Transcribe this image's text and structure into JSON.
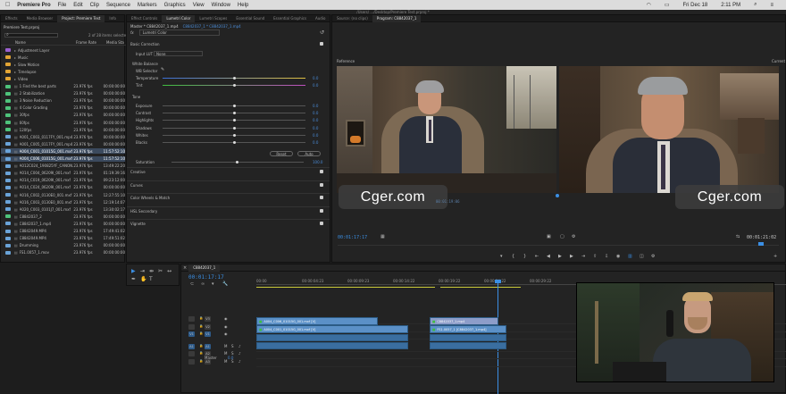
{
  "menubar": {
    "apple": "",
    "app": "Premiere Pro",
    "items": [
      "File",
      "Edit",
      "Clip",
      "Sequence",
      "Markers",
      "Graphics",
      "View",
      "Window",
      "Help"
    ],
    "right": [
      "Fri Dec 18",
      "2:11 PM"
    ]
  },
  "titlebar": "/Users/ .../Desktop/Premiere Test.prproj *",
  "project": {
    "tabs": [
      "Effects",
      "Media Browser",
      "Project: Premiere Test",
      "Info"
    ],
    "active_tab": 2,
    "name": "Premiere Test.prproj",
    "count": "2 of 28 items selected",
    "headers": [
      "Name",
      "Frame Rate",
      "Media Sta"
    ],
    "items": [
      {
        "name": "Adjustment Layer",
        "color": "#9b5fcf",
        "fps": "",
        "start": ""
      },
      {
        "name": "Music",
        "color": "#e1a434",
        "fps": "",
        "start": ""
      },
      {
        "name": "Slow Motion",
        "color": "#e1a434",
        "fps": "",
        "start": ""
      },
      {
        "name": "Timelapse",
        "color": "#e1a434",
        "fps": "",
        "start": ""
      },
      {
        "name": "Video",
        "color": "#e1a434",
        "fps": "",
        "start": ""
      },
      {
        "name": "1 Find the best parts",
        "color": "#4ec27b",
        "fps": "23.976 fps",
        "start": "00:00:00:00"
      },
      {
        "name": "2 Stabilization",
        "color": "#4ec27b",
        "fps": "23.976 fps",
        "start": "00:00:00:00"
      },
      {
        "name": "3 Noise Reduction",
        "color": "#4ec27b",
        "fps": "23.976 fps",
        "start": "00:00:00:00"
      },
      {
        "name": "4 Color Grading",
        "color": "#4ec27b",
        "fps": "23.976 fps",
        "start": "00:00:00:00"
      },
      {
        "name": "30fps",
        "color": "#4ec27b",
        "fps": "23.976 fps",
        "start": "00:00:00:00"
      },
      {
        "name": "60fps",
        "color": "#4ec27b",
        "fps": "23.976 fps",
        "start": "00:00:00:00"
      },
      {
        "name": "120fps",
        "color": "#4ec27b",
        "fps": "23.976 fps",
        "start": "00:00:00:00"
      },
      {
        "name": "A001_C003_0117FY_001.mp4",
        "color": "#6aa3d8",
        "fps": "23.976 fps",
        "start": "00:00:00:00"
      },
      {
        "name": "A001_C005_0117FY_001.mp4",
        "color": "#6aa3d8",
        "fps": "23.976 fps",
        "start": "00:00:00:00"
      },
      {
        "name": "A004_C001_01015G_001.mxf",
        "color": "#6aa3d8",
        "fps": "23.976 fps",
        "start": "11:57:52:10",
        "sel": true
      },
      {
        "name": "A004_C006_01015G_001.mxf",
        "color": "#6aa3d8",
        "fps": "23.976 fps",
        "start": "11:57:52:10",
        "sel": true
      },
      {
        "name": "A012C024_190825YF_CANON.MXF",
        "color": "#6aa3d8",
        "fps": "23.976 fps",
        "start": "13:49:22:20"
      },
      {
        "name": "A014_C004_06209I_001.mxf",
        "color": "#6aa3d8",
        "fps": "23.976 fps",
        "start": "01:19:39:16"
      },
      {
        "name": "A014_C019_06209I_001.mxf",
        "color": "#6aa3d8",
        "fps": "23.976 fps",
        "start": "09:23:12:00"
      },
      {
        "name": "A014_C024_06209I_001.mxf",
        "color": "#6aa3d8",
        "fps": "23.976 fps",
        "start": "00:00:00:00"
      },
      {
        "name": "A016_C002_0130E0_001.mxf",
        "color": "#6aa3d8",
        "fps": "23.976 fps",
        "start": "12:27:55:10"
      },
      {
        "name": "A016_C003_0130E0_001.mxf",
        "color": "#6aa3d8",
        "fps": "23.976 fps",
        "start": "12:19:14:07"
      },
      {
        "name": "A020_C003_0101J7_001.mxf",
        "color": "#6aa3d8",
        "fps": "23.976 fps",
        "start": "13:30:02:17"
      },
      {
        "name": "C8842037_2",
        "color": "#4ec27b",
        "fps": "23.976 fps",
        "start": "00:00:00:00"
      },
      {
        "name": "C8842037_1.mp4",
        "color": "#6aa3d8",
        "fps": "23.976 fps",
        "start": "00:00:00:00"
      },
      {
        "name": "C8842049.MP4",
        "color": "#6aa3d8",
        "fps": "23.976 fps",
        "start": "17:49:41:02"
      },
      {
        "name": "C8842049.MP4",
        "color": "#6aa3d8",
        "fps": "23.976 fps",
        "start": "17:49:51:02"
      },
      {
        "name": "Drumming",
        "color": "#6aa3d8",
        "fps": "23.976 fps",
        "start": "00:00:00:00"
      },
      {
        "name": "FS1.0057_1.mov",
        "color": "#6aa3d8",
        "fps": "23.976 fps",
        "start": "00:00:00:00"
      }
    ]
  },
  "lumetri": {
    "tabs": [
      "Effect Controls",
      "Lumetri Color",
      "Lumetri Scopes",
      "Essential Sound",
      "Essential Graphics",
      "Audio"
    ],
    "active_tab": 1,
    "master": "Master * C8842037_1.mp4",
    "clip": "C8842037_1 * C8842037_1.mp4",
    "fx": "fx",
    "fxname": "Lumetri Color",
    "basic": "Basic Correction",
    "input_lut_label": "Input LUT",
    "input_lut": "None",
    "white_balance": "White Balance",
    "wb_selector": "WB Selector",
    "sliders": [
      {
        "label": "Temperature",
        "value": "0.0",
        "pos": 0.5,
        "grad": "linear-gradient(90deg,#3a6fd8,#e0c040)"
      },
      {
        "label": "Tint",
        "value": "0.0",
        "pos": 0.5,
        "grad": "linear-gradient(90deg,#3fbf3f,#c04fc0)"
      }
    ],
    "tone": "Tone",
    "tone_sliders": [
      {
        "label": "Exposure",
        "value": "0.0",
        "pos": 0.5
      },
      {
        "label": "Contrast",
        "value": "0.0",
        "pos": 0.5
      },
      {
        "label": "Highlights",
        "value": "0.0",
        "pos": 0.5
      },
      {
        "label": "Shadows",
        "value": "0.0",
        "pos": 0.5
      },
      {
        "label": "Whites",
        "value": "0.0",
        "pos": 0.5
      },
      {
        "label": "Blacks",
        "value": "0.0",
        "pos": 0.5
      }
    ],
    "reset": "Reset",
    "auto": "Auto",
    "saturation_label": "Saturation",
    "saturation": "100.0",
    "sections": [
      "Creative",
      "Curves",
      "Color Wheels & Match",
      "HSL Secondary",
      "Vignette"
    ]
  },
  "source": {
    "tabs": [
      "Source: (no clips)",
      "Program: C8842037_1"
    ],
    "reference": "Reference",
    "current": "Current",
    "tc_left": "00:01:17:17",
    "tc_right": "00:01:21:02",
    "tc_mid": "00:01:19:06"
  },
  "watermark": "Cger.com",
  "timeline": {
    "tab": "C8842037_1",
    "timecode": "00:01:17:17",
    "ruler": [
      "00:00",
      "00:00:04:23",
      "00:00:09:23",
      "00:00:14:22",
      "00:00:19:22",
      "00:00:24:22",
      "00:00:29:22"
    ],
    "tracks": [
      "V3",
      "V2",
      "V1",
      "A1",
      "A2",
      "A3"
    ],
    "master": "Master",
    "master_val": "0.0",
    "clips": [
      {
        "label": "A004_C006_01015G_001.mxf [V]",
        "row": 1
      },
      {
        "label": "A004_C001_01015G_001.mxf [V]",
        "row": 2
      },
      {
        "label": "C8842037_1.mp4",
        "row": 1
      },
      {
        "label": "FS1.0057_1 [C8842037_1.mp4]",
        "row": 2
      }
    ]
  }
}
